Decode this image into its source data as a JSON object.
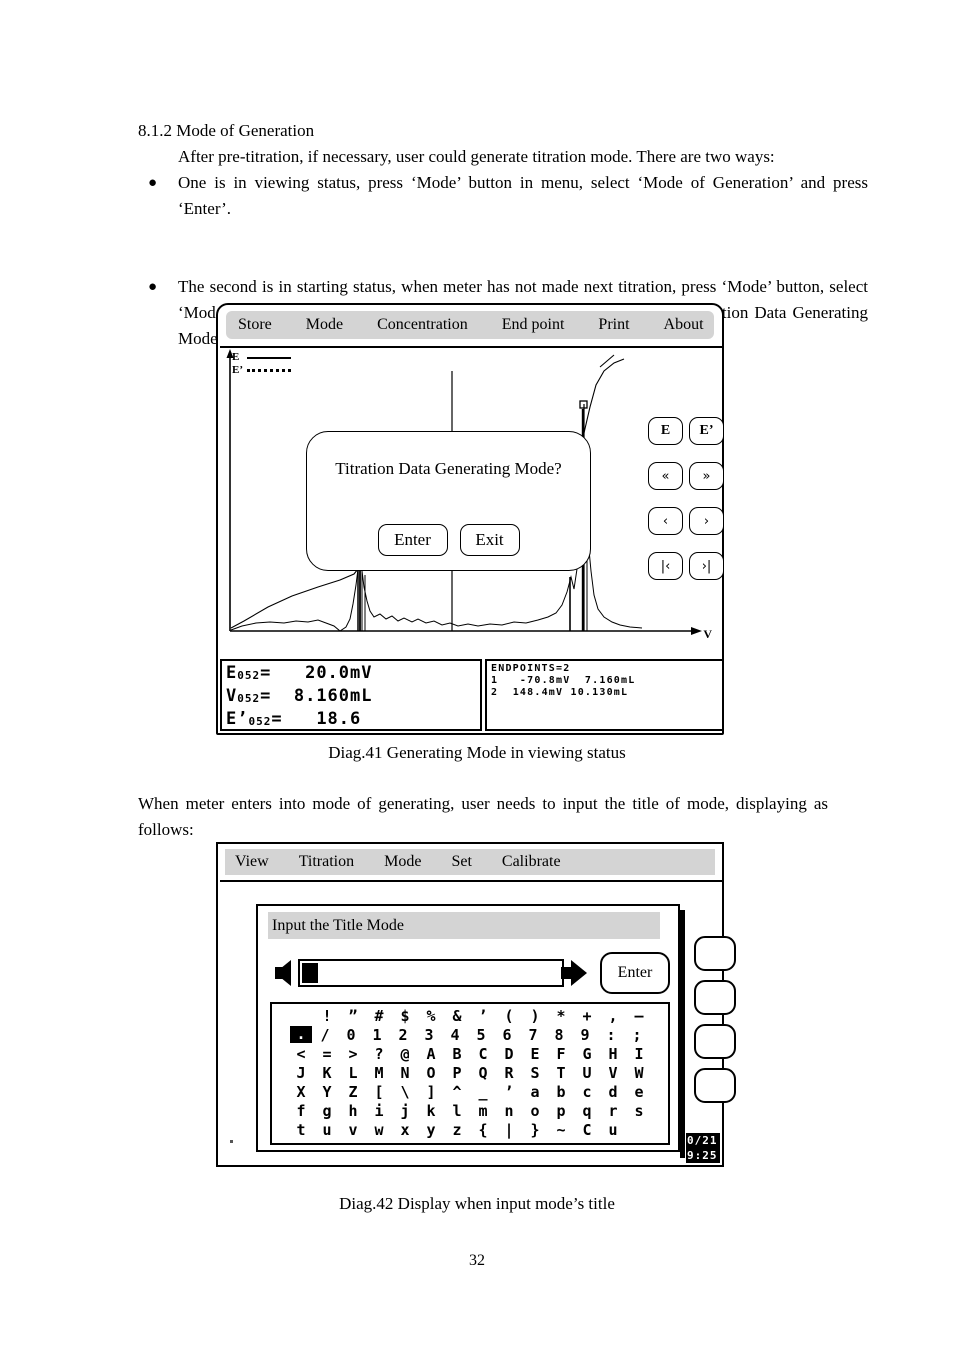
{
  "document": {
    "heading": "8.1.2 Mode of Generation",
    "intro": "After pre-titration, if necessary, user could generate titration mode. There are two ways:",
    "bullets": [
      "One is in viewing status, press ‘Mode’ button in menu, select ‘Mode of Generation’ and press ‘Enter’.",
      "The second is in starting status, when meter has not made next titration, press ‘Mode’ button, select ‘Mode of Generation’ and then press ‘Enter’ button. Meter will display ‘Titration Data Generating Mode?’ press ‘Enter’ to arrange mode of generation."
    ],
    "mid_paragraph": "When meter enters into mode of generating, user needs to input the title of mode, displaying as follows:",
    "caption_41": "Diag.41 Generating Mode in viewing status",
    "caption_42": "Diag.42 Display when input mode’s title",
    "page_number": "32"
  },
  "diag41": {
    "menu": [
      "Store",
      "Mode",
      "Concentration",
      "End point",
      "Print",
      "About"
    ],
    "legend": [
      {
        "label": "E",
        "style": "solid"
      },
      {
        "label": "E’",
        "style": "dotted"
      }
    ],
    "axis_x_label": "V",
    "dialog": {
      "message": "Titration Data Generating Mode?",
      "enter_label": "Enter",
      "exit_label": "Exit"
    },
    "nav_buttons": [
      [
        "E",
        "E’"
      ],
      [
        "«",
        "»"
      ],
      [
        "‹",
        "›"
      ],
      [
        "|‹",
        "›|"
      ]
    ],
    "readout_left": [
      {
        "symbol": "E",
        "index": "052",
        "value": "20.0",
        "unit": "mV"
      },
      {
        "symbol": "V",
        "index": "052",
        "value": "8.160",
        "unit": "mL"
      },
      {
        "symbol": "E’",
        "index": "052",
        "value": "18.6",
        "unit": ""
      }
    ],
    "readout_right": {
      "header": "ENDPOINTS=2",
      "rows": [
        {
          "n": "1",
          "mv": "-70.8mV",
          "ml": "7.160mL"
        },
        {
          "n": "2",
          "mv": "148.4mV",
          "ml": "10.130mL"
        }
      ]
    }
  },
  "diag42": {
    "menu": [
      "View",
      "Titration",
      "Mode",
      "Set",
      "Calibrate"
    ],
    "dialog_title": "Input the Title Mode",
    "input_value": "",
    "enter_label": "Enter",
    "clock_line1": "0/21",
    "clock_line2": "9:25",
    "char_grid": [
      [
        " ",
        "!",
        "”",
        "#",
        "$",
        "%",
        "&",
        "’",
        "(",
        ")",
        "*",
        "+",
        ",",
        "–"
      ],
      [
        ".",
        "/",
        "0",
        "1",
        "2",
        "3",
        "4",
        "5",
        "6",
        "7",
        "8",
        "9",
        ":",
        ";"
      ],
      [
        "<",
        "=",
        ">",
        "?",
        "@",
        "A",
        "B",
        "C",
        "D",
        "E",
        "F",
        "G",
        "H",
        "I"
      ],
      [
        "J",
        "K",
        "L",
        "M",
        "N",
        "O",
        "P",
        "Q",
        "R",
        "S",
        "T",
        "U",
        "V",
        "W"
      ],
      [
        "X",
        "Y",
        "Z",
        "[",
        "\\",
        "]",
        "^",
        "_",
        "’",
        "a",
        "b",
        "c",
        "d",
        "e"
      ],
      [
        "f",
        "g",
        "h",
        "i",
        "j",
        "k",
        "l",
        "m",
        "n",
        "o",
        "p",
        "q",
        "r",
        "s"
      ],
      [
        "t",
        "u",
        "v",
        "w",
        "x",
        "y",
        "z",
        "{",
        "|",
        "}",
        "~",
        "C",
        "u",
        " "
      ]
    ],
    "selected_char": {
      "row": 1,
      "col": 0
    }
  },
  "chart_data": {
    "type": "line",
    "title": "",
    "xlabel": "V",
    "ylabel": "E",
    "legend": [
      "E",
      "E’"
    ],
    "legend_position": "top-left",
    "grid": false,
    "series": [
      {
        "name": "E",
        "comment": "potential curve, rising sigmoid with two inflection steps",
        "x": [
          0,
          5,
          12,
          20,
          28,
          34,
          38,
          41,
          44,
          46,
          48,
          52,
          58,
          64,
          70,
          74,
          77,
          79,
          81,
          83,
          86,
          90,
          95,
          100
        ],
        "y": [
          2,
          6,
          11,
          16,
          21,
          25,
          27,
          28,
          30,
          44,
          52,
          55,
          57,
          59,
          61,
          63,
          66,
          70,
          80,
          90,
          96,
          98,
          99,
          100
        ]
      },
      {
        "name": "E’",
        "comment": "first derivative, noisy baseline with two sharp peaks at the endpoints",
        "x": [
          0,
          8,
          16,
          24,
          30,
          36,
          40,
          43,
          45,
          46,
          47,
          48,
          50,
          54,
          60,
          66,
          70,
          74,
          77,
          79,
          80,
          81,
          82,
          84,
          88,
          94,
          100
        ],
        "y": [
          1,
          4,
          6,
          7,
          6,
          8,
          5,
          2,
          9,
          30,
          58,
          34,
          18,
          12,
          9,
          8,
          10,
          12,
          16,
          30,
          70,
          92,
          60,
          24,
          12,
          8,
          6
        ]
      }
    ],
    "endpoints": [
      {
        "index": 1,
        "mv": -70.8,
        "ml": 7.16
      },
      {
        "index": 2,
        "mv": 148.4,
        "ml": 10.13
      }
    ],
    "cursor": {
      "mv": 20.0,
      "ml": 8.16,
      "derivative": 18.6,
      "point_index": "052"
    }
  }
}
